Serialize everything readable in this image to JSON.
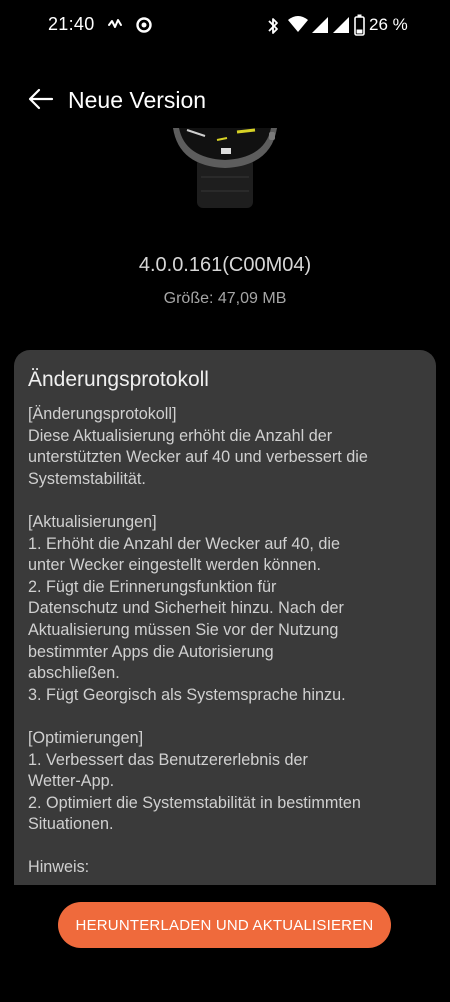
{
  "status_bar": {
    "time": "21:40",
    "battery_percent": "26 %",
    "icons": [
      "heart-rate-icon",
      "activity-ring-icon",
      "bluetooth-icon",
      "wifi-icon",
      "signal-icon",
      "signal-icon",
      "battery-icon"
    ]
  },
  "app_bar": {
    "title": "Neue Version",
    "back_icon": "arrow-left-icon"
  },
  "update": {
    "version": "4.0.0.161(C00M04)",
    "size": "Größe: 47,09 MB"
  },
  "changelog": {
    "title": "Änderungsprotokoll",
    "lines": [
      "[Änderungsprotokoll]",
      "Diese Aktualisierung erhöht die Anzahl der",
      "unterstützten Wecker auf 40 und verbessert die",
      "Systemstabilität.",
      "",
      "[Aktualisierungen]",
      "1. Erhöht die Anzahl der Wecker auf 40, die",
      "unter Wecker eingestellt werden können.",
      "2. Fügt die Erinnerungsfunktion für",
      "Datenschutz und Sicherheit hinzu. Nach der",
      "Aktualisierung müssen Sie vor der Nutzung",
      "bestimmter Apps die Autorisierung",
      "abschließen.",
      "3. Fügt Georgisch als Systemsprache hinzu.",
      "",
      "[Optimierungen]",
      "1. Verbessert das Benutzererlebnis der",
      "Wetter-App.",
      "2. Optimiert die Systemstabilität in bestimmten",
      "Situationen.",
      "",
      "Hinweis:"
    ]
  },
  "actions": {
    "download_label": "HERUNTERLADEN UND AKTUALISIEREN"
  },
  "colors": {
    "background": "#000000",
    "card": "#3a3a3a",
    "accent": "#ef6a3c"
  }
}
